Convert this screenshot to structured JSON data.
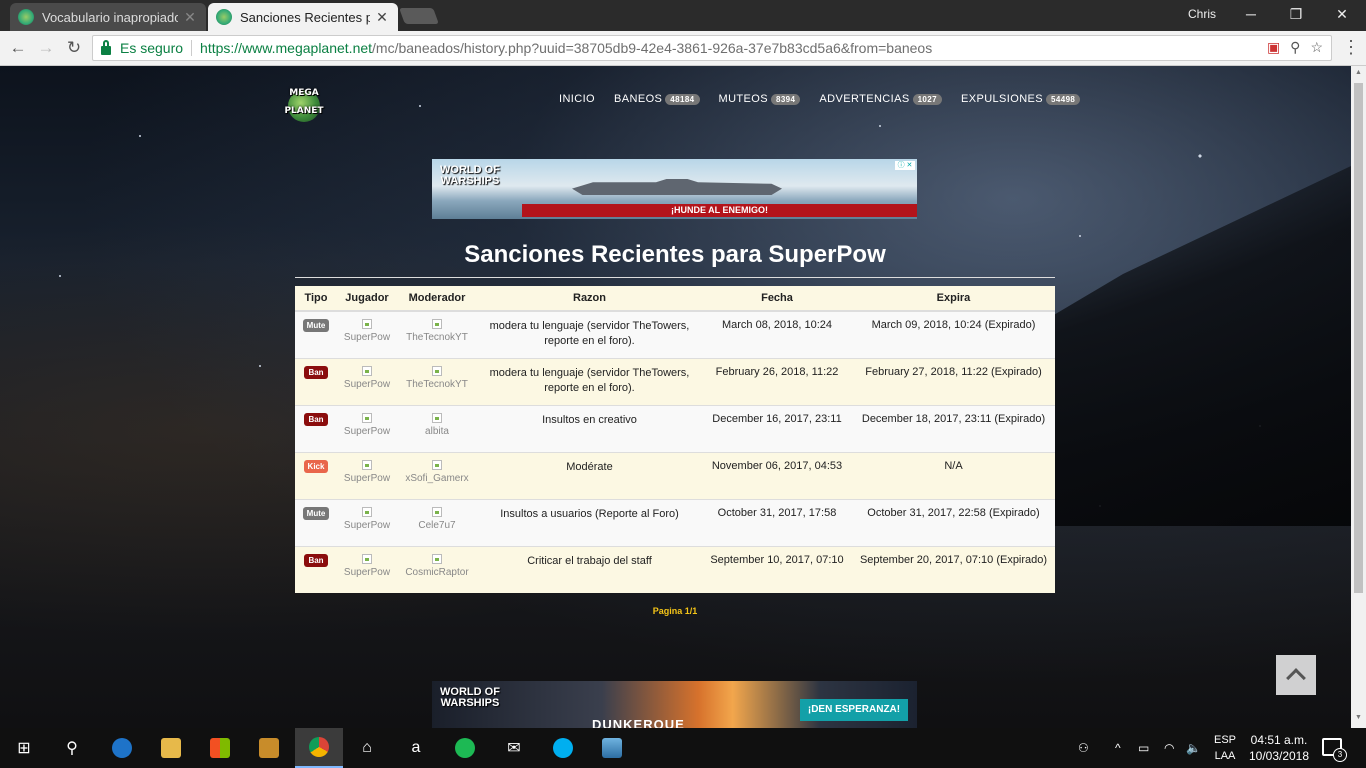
{
  "browser": {
    "tabs": [
      {
        "title": "Vocabulario inapropiado",
        "active": false
      },
      {
        "title": "Sanciones Recientes para",
        "active": true
      }
    ],
    "user": "Chris",
    "secure_label": "Es seguro",
    "url_scheme_host": "https://www.megaplanet.net",
    "url_path": "/mc/baneados/history.php?uuid=38705db9-42e4-3861-926a-37e7b83cd5a6&from=baneos"
  },
  "site": {
    "logo_top": "MEGA",
    "logo_bottom": "PLANET",
    "nav": [
      {
        "label": "INICIO",
        "count": ""
      },
      {
        "label": "BANEOS",
        "count": "48184"
      },
      {
        "label": "MUTEOS",
        "count": "8394"
      },
      {
        "label": "ADVERTENCIAS",
        "count": "1027"
      },
      {
        "label": "EXPULSIONES",
        "count": "54498"
      }
    ]
  },
  "ads": {
    "top": {
      "logo": "WORLD OF WARSHIPS",
      "slogan": "¡HUNDE AL ENEMIGO!"
    },
    "bottom": {
      "logo": "WORLD OF WARSHIPS",
      "brand": "DUNKERQUE",
      "cta": "¡DEN ESPERANZA!"
    }
  },
  "page_title": "Sanciones Recientes para SuperPow",
  "table": {
    "headers": [
      "Tipo",
      "Jugador",
      "Moderador",
      "Razon",
      "Fecha",
      "Expira"
    ],
    "rows": [
      {
        "tipo": "Mute",
        "jugador": "SuperPow",
        "moderador": "TheTecnokYT",
        "razon": "modera tu lenguaje (servidor TheTowers, reporte en el foro).",
        "fecha": "March 08, 2018, 10:24",
        "expira": "March 09, 2018, 10:24 (Expirado)"
      },
      {
        "tipo": "Ban",
        "jugador": "SuperPow",
        "moderador": "TheTecnokYT",
        "razon": "modera tu lenguaje (servidor TheTowers, reporte en el foro).",
        "fecha": "February 26, 2018, 11:22",
        "expira": "February 27, 2018, 11:22 (Expirado)"
      },
      {
        "tipo": "Ban",
        "jugador": "SuperPow",
        "moderador": "albita",
        "razon": "Insultos en creativo",
        "fecha": "December 16, 2017, 23:11",
        "expira": "December 18, 2017, 23:11 (Expirado)"
      },
      {
        "tipo": "Kick",
        "jugador": "SuperPow",
        "moderador": "xSofi_Gamerx",
        "razon": "Modérate",
        "fecha": "November 06, 2017, 04:53",
        "expira": "N/A"
      },
      {
        "tipo": "Mute",
        "jugador": "SuperPow",
        "moderador": "Cele7u7",
        "razon": "Insultos a usuarios (Reporte al Foro)",
        "fecha": "October 31, 2017, 17:58",
        "expira": "October 31, 2017, 22:58 (Expirado)"
      },
      {
        "tipo": "Ban",
        "jugador": "SuperPow",
        "moderador": "CosmicRaptor",
        "razon": "Criticar el trabajo del staff",
        "fecha": "September 10, 2017, 07:10",
        "expira": "September 20, 2017, 07:10 (Expirado)"
      }
    ]
  },
  "pager": "Pagina 1/1",
  "type_colors": {
    "Mute": "#777777",
    "Ban": "#8b0d0d",
    "Kick": "#e9664b"
  },
  "taskbar": {
    "lang_line1": "ESP",
    "lang_line2": "LAA",
    "time": "04:51 a.m.",
    "date": "10/03/2018",
    "notifications": "3"
  }
}
